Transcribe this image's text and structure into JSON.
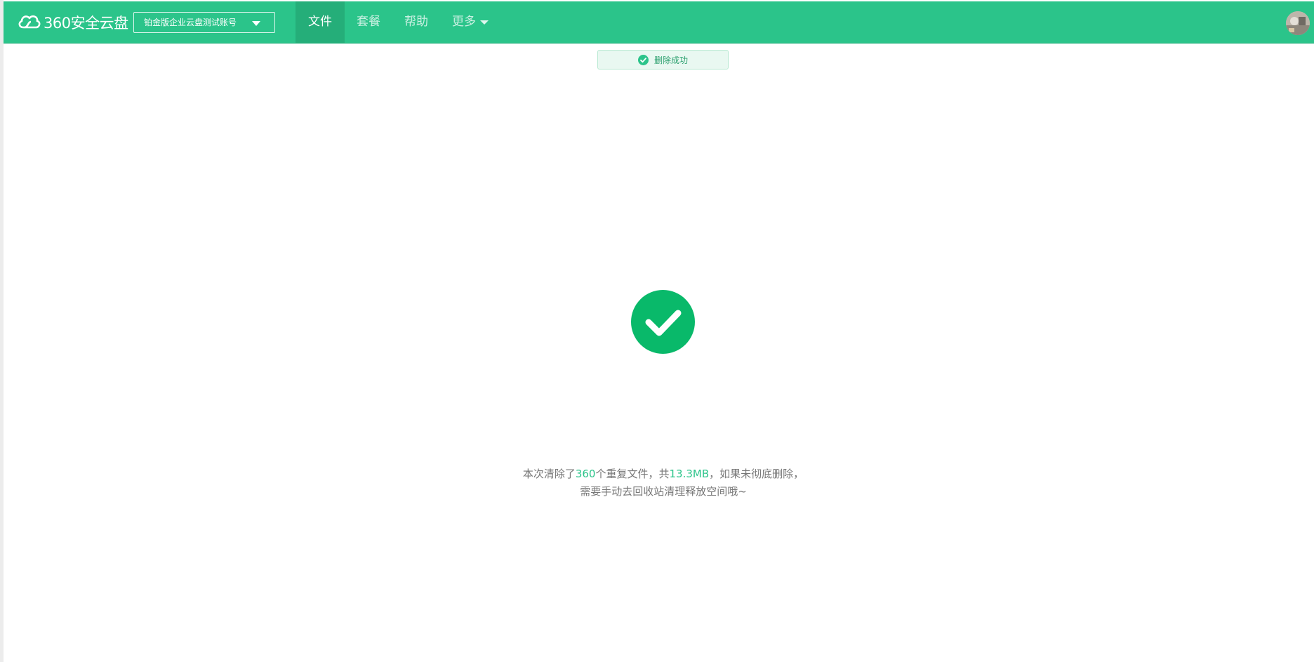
{
  "header": {
    "logo_text": "360安全云盘",
    "account_select": {
      "value": "铂金版企业云盘测试账号"
    },
    "nav": [
      {
        "label": "文件",
        "active": true
      },
      {
        "label": "套餐",
        "active": false
      },
      {
        "label": "帮助",
        "active": false
      },
      {
        "label": "更多",
        "active": false,
        "has_dropdown": true
      }
    ]
  },
  "toast": {
    "text": "删除成功"
  },
  "result": {
    "line1_prefix": "本次清除了",
    "file_count": "360",
    "line1_middle": "个重复文件，共",
    "size": "13.3MB",
    "line1_suffix": "，如果未彻底删除，",
    "line2": "需要手动去回收站清理释放空间哦~"
  },
  "colors": {
    "brand": "#2bc48a",
    "nav_active_bg": "#25ae79",
    "success_check": "#09b96a",
    "toast_bg": "#e9f8f1",
    "message_text": "#777777"
  },
  "icons": {
    "logo": "cloud-logo-icon",
    "account_dropdown": "caret-down-icon",
    "more_dropdown": "caret-down-icon",
    "toast": "check-circle-icon",
    "result": "success-check-icon"
  }
}
